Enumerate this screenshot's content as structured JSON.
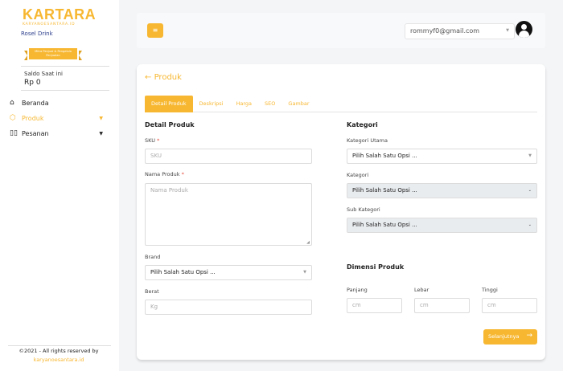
{
  "sidebar": {
    "logo": "KARTARA",
    "logo_sub": "KARYANOESANTARA.ID",
    "store_name": "Rosel Drink",
    "ribbon_text": "Mitra Penjual & Pengelola Penjualan",
    "saldo_label": "Saldo Saat ini",
    "saldo_value": "Rp 0",
    "nav": [
      {
        "label": "Beranda",
        "icon": "home-icon"
      },
      {
        "label": "Produk",
        "icon": "box-icon",
        "active": true
      },
      {
        "label": "Pesanan",
        "icon": "book-icon"
      }
    ],
    "footer_text": "©2021 - All rights reserved by",
    "footer_link": "karyanoesantara.id"
  },
  "topbar": {
    "menu_icon": "≡",
    "user_email": "rommyf0@gmail.com"
  },
  "main": {
    "back_label": "Produk",
    "tabs": [
      "Detail Produk",
      "Deskripsi",
      "Harga",
      "SEO",
      "Gambar"
    ],
    "detail": {
      "title": "Detail Produk",
      "sku_label": "SKU",
      "sku_placeholder": "SKU",
      "name_label": "Nama Produk",
      "name_placeholder": "Nama Produk",
      "brand_label": "Brand",
      "brand_value": "Pilih Salah Satu Opsi ...",
      "weight_label": "Berat",
      "weight_placeholder": "Kg"
    },
    "category": {
      "title": "Kategori",
      "main_label": "Kategori Utama",
      "main_value": "Pilih Salah Satu Opsi ...",
      "cat_label": "Kategori",
      "cat_value": "Pilih Salah Satu Opsi ...",
      "sub_label": "Sub Kategori",
      "sub_value": "Pilih Salah Satu Opsi ..."
    },
    "dimension": {
      "title": "Dimensi Produk",
      "length_label": "Panjang",
      "width_label": "Lebar",
      "height_label": "Tinggi",
      "unit": "cm"
    },
    "next_label": "Selanjutnya"
  }
}
